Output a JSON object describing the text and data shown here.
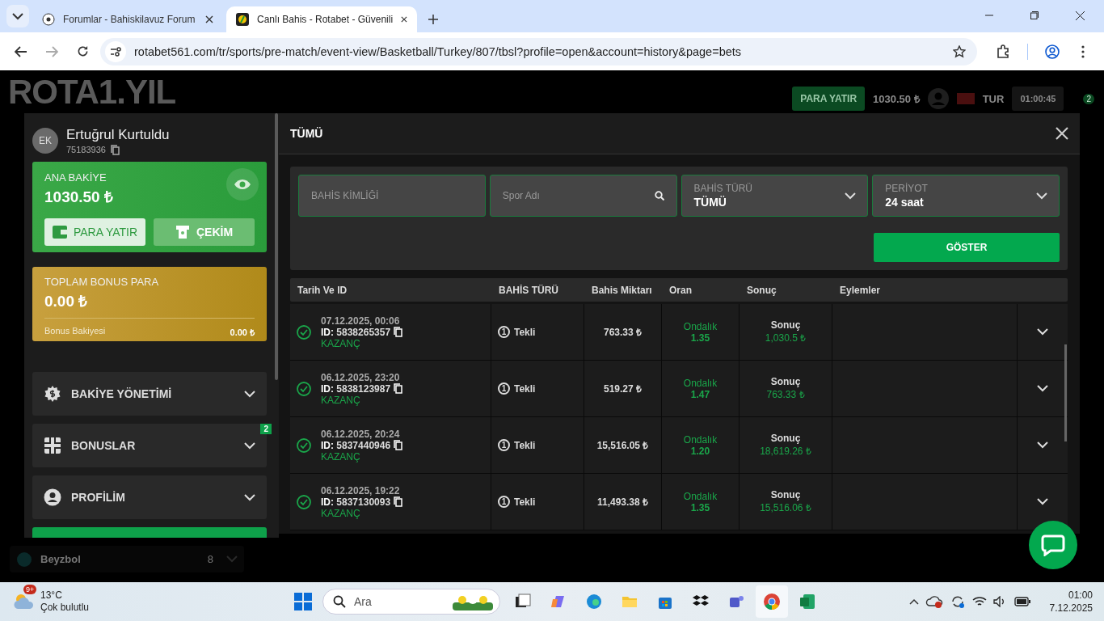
{
  "browser": {
    "tabs": [
      {
        "title": "Forumlar - Bahiskilavuz Forum",
        "selected": false
      },
      {
        "title": "Canlı Bahis - Rotabet - Güvenili",
        "selected": true
      }
    ],
    "url": "rotabet561.com/tr/sports/pre-match/event-view/Basketball/Turkey/807/tbsl?profile=open&account=history&page=bets"
  },
  "site_header": {
    "logo": "ROTA1.YIL",
    "deposit_button": "PARA YATIR",
    "balance": "1030.50 ₺",
    "language": "TUR",
    "clock": "01:00:45",
    "menu_badge": "2"
  },
  "sport_list": [
    {
      "name": "Beyzbol",
      "count": "8"
    }
  ],
  "account_panel": {
    "avatar_initials": "EK",
    "name": "Ertuğrul Kurtuldu",
    "user_id": "75183936",
    "main_balance": {
      "label": "ANA BAKİYE",
      "amount": "1030.50 ₺",
      "deposit_button": "PARA YATIR",
      "withdraw_button": "ÇEKİM"
    },
    "bonus_balance": {
      "label": "TOPLAM BONUS PARA",
      "amount": "0.00 ₺",
      "detail_label": "Bonus Bakiyesi",
      "detail_amount": "0.00 ₺"
    },
    "menu": [
      {
        "kind": "balance",
        "label": "BAKİYE YÖNETİMİ"
      },
      {
        "kind": "bonus",
        "label": "BONUSLAR",
        "badge": "2"
      },
      {
        "kind": "profile",
        "label": "PROFİLİM"
      }
    ]
  },
  "bets_dialog": {
    "title": "TÜMÜ",
    "filters": {
      "bet_id": {
        "placeholder": "BAHİS KİMLİĞİ"
      },
      "sport": {
        "placeholder": "Spor Adı"
      },
      "bet_type": {
        "label": "BAHİS TÜRÜ",
        "value": "TÜMÜ"
      },
      "period": {
        "label": "PERİYOT",
        "value": "24 saat"
      },
      "show_button": "GÖSTER"
    },
    "table": {
      "columns": [
        "Tarih Ve ID",
        "BAHİS TÜRÜ",
        "Bahis Miktarı",
        "Oran",
        "Sonuç",
        "Eylemler"
      ],
      "rows": [
        {
          "date": "07.12.2025, 00:06",
          "id_label": "ID:",
          "id": "5838265357",
          "status": "KAZANÇ",
          "type_number": "1",
          "type": "Tekli",
          "amount": "763.33 ₺",
          "odds_label": "Ondalık",
          "odds": "1.35",
          "result_label": "Sonuç",
          "result": "1,030.5 ₺"
        },
        {
          "date": "06.12.2025, 23:20",
          "id_label": "ID:",
          "id": "5838123987",
          "status": "KAZANÇ",
          "type_number": "1",
          "type": "Tekli",
          "amount": "519.27 ₺",
          "odds_label": "Ondalık",
          "odds": "1.47",
          "result_label": "Sonuç",
          "result": "763.33 ₺"
        },
        {
          "date": "06.12.2025, 20:24",
          "id_label": "ID:",
          "id": "5837440946",
          "status": "KAZANÇ",
          "type_number": "1",
          "type": "Tekli",
          "amount": "15,516.05 ₺",
          "odds_label": "Ondalık",
          "odds": "1.20",
          "result_label": "Sonuç",
          "result": "18,619.26 ₺"
        },
        {
          "date": "06.12.2025, 19:22",
          "id_label": "ID:",
          "id": "5837130093",
          "status": "KAZANÇ",
          "type_number": "1",
          "type": "Tekli",
          "amount": "11,493.38 ₺",
          "odds_label": "Ondalık",
          "odds": "1.35",
          "result_label": "Sonuç",
          "result": "15,516.06 ₺"
        }
      ]
    }
  },
  "taskbar": {
    "weather": {
      "badge": "9+",
      "temperature": "13°C",
      "condition": "Çok bulutlu"
    },
    "search": {
      "placeholder": "Ara"
    },
    "clock": {
      "time": "01:00",
      "date": "7.12.2025"
    }
  }
}
